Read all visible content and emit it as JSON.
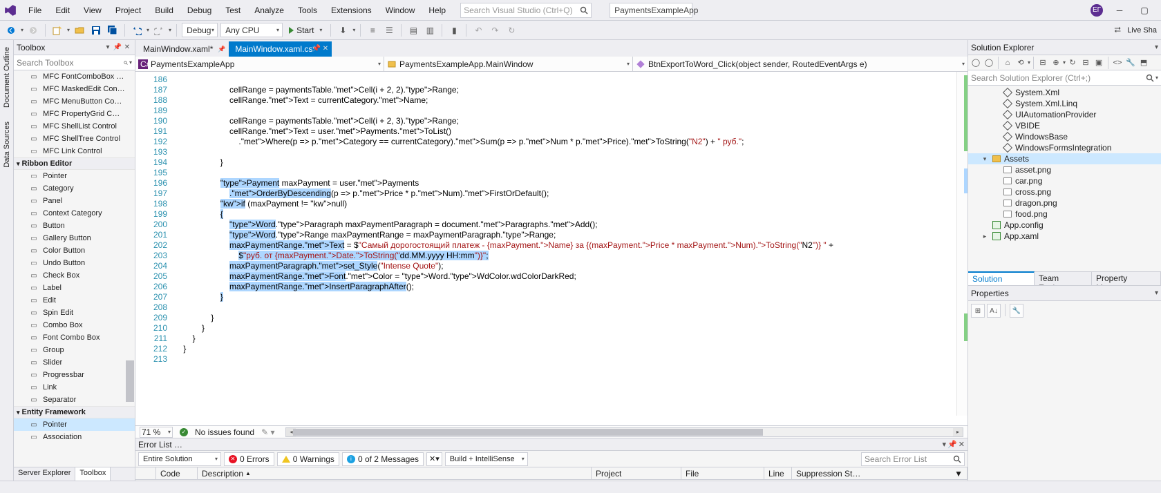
{
  "menubar": [
    "File",
    "Edit",
    "View",
    "Project",
    "Build",
    "Debug",
    "Test",
    "Analyze",
    "Tools",
    "Extensions",
    "Window",
    "Help"
  ],
  "search_placeholder": "Search Visual Studio (Ctrl+Q)",
  "solution_title": "PaymentsExampleApp",
  "avatar_initials": "ЕГ",
  "toolbar": {
    "config": "Debug",
    "platform": "Any CPU",
    "start": "Start",
    "live_share": "Live Sha"
  },
  "vtabs_left": [
    "Document Outline",
    "Data Sources"
  ],
  "toolbox": {
    "title": "Toolbox",
    "search_placeholder": "Search Toolbox",
    "items_top": [
      "MFC FontComboBox …",
      "MFC MaskedEdit Con…",
      "MFC MenuButton Co…",
      "MFC PropertyGrid C…",
      "MFC ShellList Control",
      "MFC ShellTree Control",
      "MFC Link Control"
    ],
    "group1": "Ribbon Editor",
    "items_ribbon": [
      "Pointer",
      "Category",
      "Panel",
      "Context Category",
      "Button",
      "Gallery Button",
      "Color Button",
      "Undo Button",
      "Check Box",
      "Label",
      "Edit",
      "Spin Edit",
      "Combo Box",
      "Font Combo Box",
      "Group",
      "Slider",
      "Progressbar",
      "Link",
      "Separator"
    ],
    "group2": "Entity Framework",
    "items_ef": [
      "Pointer",
      "Association"
    ],
    "bottom_tabs": [
      "Server Explorer",
      "Toolbox"
    ]
  },
  "doc_tabs": [
    {
      "label": "MainWindow.xaml*",
      "active": false
    },
    {
      "label": "MainWindow.xaml.cs*",
      "active": true
    }
  ],
  "nav_combos": [
    "PaymentsExampleApp",
    "PaymentsExampleApp.MainWindow",
    "BtnExportToWord_Click(object sender, RoutedEventArgs e)"
  ],
  "line_numbers": [
    186,
    187,
    188,
    189,
    190,
    191,
    192,
    193,
    194,
    195,
    196,
    197,
    198,
    199,
    200,
    201,
    202,
    203,
    204,
    205,
    206,
    207,
    208,
    209,
    210,
    211,
    212,
    213
  ],
  "code_lines": {
    "186": "",
    "187": "                        cellRange = paymentsTable.Cell(i + 2, 2).Range;",
    "188": "                        cellRange.Text = currentCategory.Name;",
    "189": "",
    "190": "                        cellRange = paymentsTable.Cell(i + 2, 3).Range;",
    "191": "                        cellRange.Text = user.Payments.ToList()",
    "192": "                            .Where(p => p.Category == currentCategory).Sum(p => p.Num * p.Price).ToString(\"N2\") + \" руб.\";",
    "193": "",
    "194": "                    }",
    "195": "",
    "196": "                    Payment maxPayment = user.Payments",
    "197": "                        .OrderByDescending(p => p.Price * p.Num).FirstOrDefault();",
    "198": "                    if (maxPayment != null)",
    "199": "                    {",
    "200": "                        Word.Paragraph maxPaymentParagraph = document.Paragraphs.Add();",
    "201": "                        Word.Range maxPaymentRange = maxPaymentParagraph.Range;",
    "202": "                        maxPaymentRange.Text = $\"Самый дорогостоящий платеж - {maxPayment.Name} за {(maxPayment.Price * maxPayment.Num).ToString(\"N2\")} \" +",
    "203": "                            $\"руб. от {maxPayment.Date.ToString(\"dd.MM.yyyy HH:mm\")}\";",
    "204": "                        maxPaymentParagraph.set_Style(\"Intense Quote\");",
    "205": "                        maxPaymentRange.Font.Color = Word.WdColor.wdColorDarkRed;",
    "206": "                        maxPaymentRange.InsertParagraphAfter();",
    "207": "                    }",
    "208": "",
    "209": "                }",
    "210": "            }",
    "211": "        }",
    "212": "    }",
    "213": ""
  },
  "editor_status": {
    "zoom": "71 %",
    "issues": "No issues found"
  },
  "errorlist": {
    "title": "Error List …",
    "scope": "Entire Solution",
    "errors": "0 Errors",
    "warnings": "0 Warnings",
    "messages": "0 of 2 Messages",
    "build": "Build + IntelliSense",
    "search_placeholder": "Search Error List",
    "cols": [
      "",
      "Code",
      "Description",
      "Project",
      "File",
      "Line",
      "Suppression St…"
    ]
  },
  "solution_explorer": {
    "title": "Solution Explorer",
    "search_placeholder": "Search Solution Explorer (Ctrl+;)",
    "tree": [
      {
        "indent": 2,
        "icon": "ref",
        "label": "System.Xml",
        "exp": ""
      },
      {
        "indent": 2,
        "icon": "ref",
        "label": "System.Xml.Linq",
        "exp": ""
      },
      {
        "indent": 2,
        "icon": "ref",
        "label": "UIAutomationProvider",
        "exp": ""
      },
      {
        "indent": 2,
        "icon": "ref",
        "label": "VBIDE",
        "exp": ""
      },
      {
        "indent": 2,
        "icon": "ref",
        "label": "WindowsBase",
        "exp": ""
      },
      {
        "indent": 2,
        "icon": "ref",
        "label": "WindowsFormsIntegration",
        "exp": ""
      },
      {
        "indent": 1,
        "icon": "folder",
        "label": "Assets",
        "exp": "▾",
        "sel": true
      },
      {
        "indent": 2,
        "icon": "img",
        "label": "asset.png",
        "exp": ""
      },
      {
        "indent": 2,
        "icon": "img",
        "label": "car.png",
        "exp": ""
      },
      {
        "indent": 2,
        "icon": "img",
        "label": "cross.png",
        "exp": ""
      },
      {
        "indent": 2,
        "icon": "img",
        "label": "dragon.png",
        "exp": ""
      },
      {
        "indent": 2,
        "icon": "img",
        "label": "food.png",
        "exp": ""
      },
      {
        "indent": 1,
        "icon": "cs",
        "label": "App.config",
        "exp": ""
      },
      {
        "indent": 1,
        "icon": "cs",
        "label": "App.xaml",
        "exp": "▸"
      }
    ],
    "tabs": [
      "Solution Explorer",
      "Team Explorer",
      "Property Manager"
    ]
  },
  "properties": {
    "title": "Properties"
  }
}
